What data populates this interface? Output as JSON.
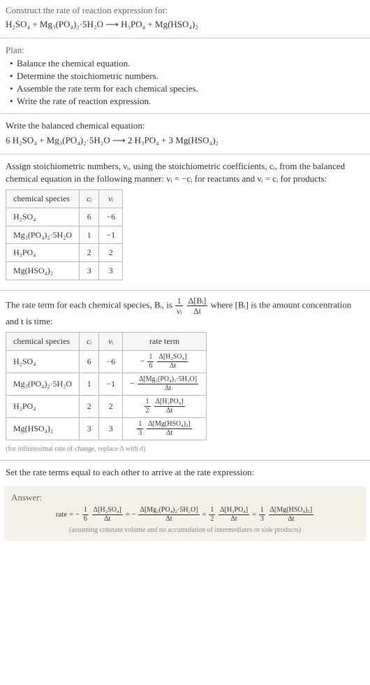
{
  "intro": {
    "prompt": "Construct the rate of reaction expression for:",
    "equation": "H₂SO₄ + Mg₃(PO₄)₂·5H₂O  ⟶  H₃PO₄ + Mg(HSO₄)₂"
  },
  "plan": {
    "title": "Plan:",
    "items": [
      "Balance the chemical equation.",
      "Determine the stoichiometric numbers.",
      "Assemble the rate term for each chemical species.",
      "Write the rate of reaction expression."
    ]
  },
  "balanced": {
    "title": "Write the balanced chemical equation:",
    "equation": "6 H₂SO₄ + Mg₃(PO₄)₂·5H₂O  ⟶  2 H₃PO₄ + 3 Mg(HSO₄)₂"
  },
  "stoich": {
    "intro": "Assign stoichiometric numbers, νᵢ, using the stoichiometric coefficients, cᵢ, from the balanced chemical equation in the following manner: νᵢ = −cᵢ for reactants and νᵢ = cᵢ for products:",
    "headers": [
      "chemical species",
      "cᵢ",
      "νᵢ"
    ],
    "rows": [
      [
        "H₂SO₄",
        "6",
        "−6"
      ],
      [
        "Mg₃(PO₄)₂·5H₂O",
        "1",
        "−1"
      ],
      [
        "H₃PO₄",
        "2",
        "2"
      ],
      [
        "Mg(HSO₄)₂",
        "3",
        "3"
      ]
    ]
  },
  "rateterm": {
    "intro_a": "The rate term for each chemical species, Bᵢ, is ",
    "intro_b": " where [Bᵢ] is the amount concentration and t is time:",
    "frac_outer_num": "1",
    "frac_outer_den": "νᵢ",
    "frac_inner_num": "Δ[Bᵢ]",
    "frac_inner_den": "Δt",
    "headers": [
      "chemical species",
      "cᵢ",
      "νᵢ",
      "rate term"
    ],
    "rows": [
      {
        "species": "H₂SO₄",
        "c": "6",
        "v": "−6",
        "sign": "−",
        "coef_num": "1",
        "coef_den": "6",
        "conc": "Δ[H₂SO₄]"
      },
      {
        "species": "Mg₃(PO₄)₂·5H₂O",
        "c": "1",
        "v": "−1",
        "sign": "−",
        "coef_num": "",
        "coef_den": "",
        "conc": "Δ[Mg₃(PO₄)₂·5H₂O]"
      },
      {
        "species": "H₃PO₄",
        "c": "2",
        "v": "2",
        "sign": "",
        "coef_num": "1",
        "coef_den": "2",
        "conc": "Δ[H₃PO₄]"
      },
      {
        "species": "Mg(HSO₄)₂",
        "c": "3",
        "v": "3",
        "sign": "",
        "coef_num": "1",
        "coef_den": "3",
        "conc": "Δ[Mg(HSO₄)₂]"
      }
    ],
    "note": "(for infinitesimal rate of change, replace Δ with d)"
  },
  "final": {
    "intro": "Set the rate terms equal to each other to arrive at the rate expression:",
    "answer_label": "Answer:",
    "rate_label": "rate = ",
    "dt": "Δt",
    "note": "(assuming constant volume and no accumulation of intermediates or side products)"
  }
}
